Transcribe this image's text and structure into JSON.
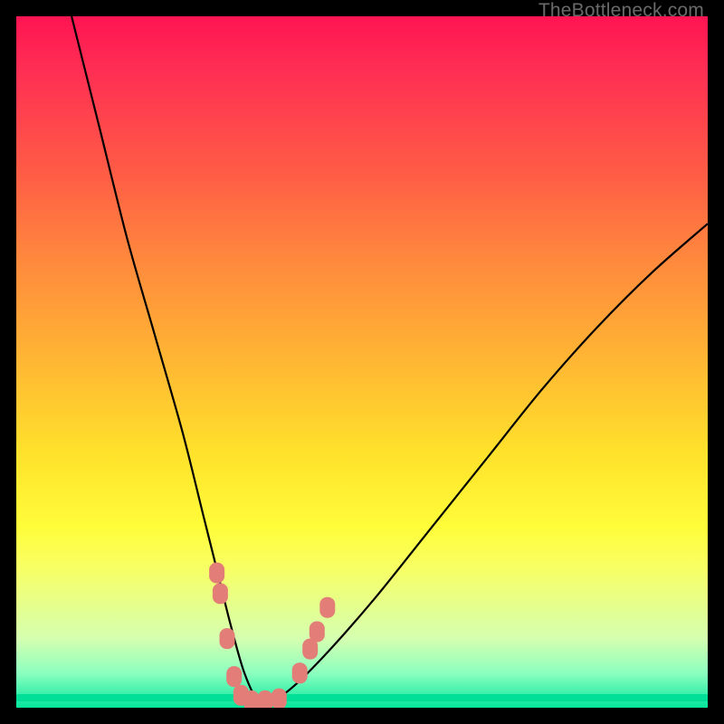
{
  "watermark": "TheBottleneck.com",
  "colors": {
    "frame": "#000000",
    "gradient_top": "#ff1452",
    "gradient_mid": "#ffe12b",
    "gradient_bottom": "#04e69c",
    "curve": "#000000",
    "marker": "#e37d77"
  },
  "chart_data": {
    "type": "line",
    "title": "",
    "xlabel": "",
    "ylabel": "",
    "xlim": [
      0,
      100
    ],
    "ylim": [
      0,
      100
    ],
    "series": [
      {
        "name": "bottleneck-curve",
        "x": [
          8,
          12,
          16,
          20,
          24,
          27,
          29,
          31,
          33,
          35,
          37,
          40,
          45,
          52,
          60,
          68,
          76,
          84,
          92,
          100
        ],
        "y": [
          100,
          84,
          68,
          54,
          40,
          28,
          20,
          12,
          5,
          1,
          1,
          3,
          8,
          16,
          26,
          36,
          46,
          55,
          63,
          70
        ]
      }
    ],
    "markers": [
      {
        "x": 29.0,
        "y": 19.5
      },
      {
        "x": 29.5,
        "y": 16.5
      },
      {
        "x": 30.5,
        "y": 10.0
      },
      {
        "x": 31.5,
        "y": 4.5
      },
      {
        "x": 32.5,
        "y": 1.8
      },
      {
        "x": 34.0,
        "y": 1.0
      },
      {
        "x": 36.0,
        "y": 1.0
      },
      {
        "x": 38.0,
        "y": 1.3
      },
      {
        "x": 41.0,
        "y": 5.0
      },
      {
        "x": 42.5,
        "y": 8.5
      },
      {
        "x": 43.5,
        "y": 11.0
      },
      {
        "x": 45.0,
        "y": 14.5
      }
    ]
  }
}
